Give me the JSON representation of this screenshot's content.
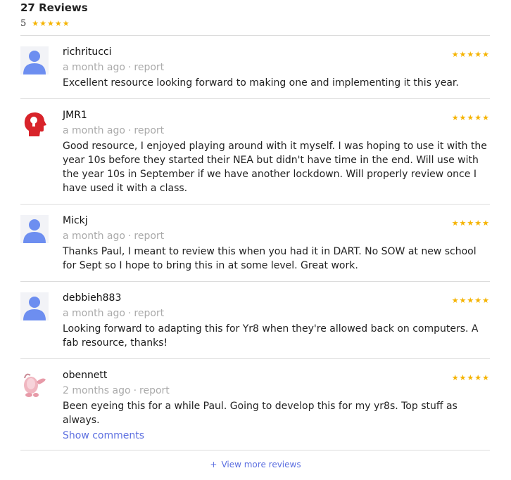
{
  "summary": {
    "title": "27 Reviews",
    "rating": "5",
    "stars": "★★★★★"
  },
  "reviews": [
    {
      "author": "richritucci",
      "stars": "★★★★★",
      "time": "a month ago",
      "sep": "·",
      "report": "report",
      "text": "Excellent resource looking forward to making one and implementing it this year.",
      "avatar_icon": "user-silhouette-icon"
    },
    {
      "author": "JMR1",
      "stars": "★★★★★",
      "time": "a month ago",
      "sep": "·",
      "report": "report",
      "text": "Good resource, I enjoyed playing around with it myself. I was hoping to use it with the year 10s before they started their NEA but didn't have time in the end. Will use with the year 10s in September if we have another lockdown. Will properly review once I have used it with a class.",
      "avatar_icon": "lightbulb-head-icon"
    },
    {
      "author": "Mickj",
      "stars": "★★★★★",
      "time": "a month ago",
      "sep": "·",
      "report": "report",
      "text": "Thanks Paul, I meant to review this when you had it in DART. No SOW at new school for Sept so I hope to bring this in at some level. Great work.",
      "avatar_icon": "user-silhouette-icon"
    },
    {
      "author": "debbieh883",
      "stars": "★★★★★",
      "time": "a month ago",
      "sep": "·",
      "report": "report",
      "text": "Looking forward to adapting this for Yr8 when they're allowed back on computers. A fab resource, thanks!",
      "avatar_icon": "user-silhouette-icon"
    },
    {
      "author": "obennett",
      "stars": "★★★★★",
      "time": "2 months ago",
      "sep": "·",
      "report": "report",
      "text": "Been eyeing this for a while Paul. Going to develop this for my yr8s. Top stuff as always.",
      "avatar_icon": "pink-creature-icon",
      "show_comments": "Show comments"
    }
  ],
  "footer": {
    "plus": "+",
    "more_label": "View more reviews"
  },
  "colors": {
    "star": "#f5b301",
    "link": "#5c6fe0",
    "avatar_blue": "#6d8ef0",
    "avatar_red": "#d8232a"
  }
}
